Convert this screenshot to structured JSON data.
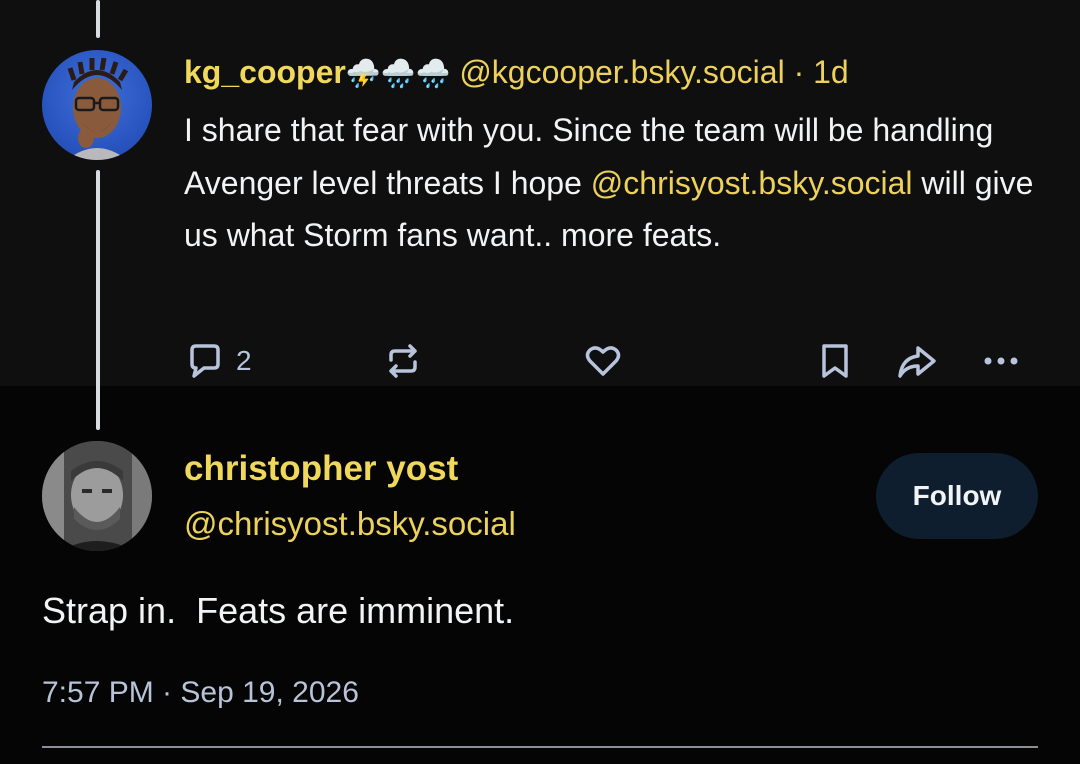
{
  "reply": {
    "display_name": "kg_cooper",
    "name_emojis": "⛈️🌧️🌧️",
    "handle": "@kgcooper.bsky.social",
    "separator": "·",
    "time_ago": "1d",
    "text_before": "I share that fear with you. Since the team will be handling Avenger level threats I hope ",
    "mention": "@chrisyost.bsky.social",
    "text_after": " will give us what Storm fans want.. more feats.",
    "reply_count": "2",
    "icons": [
      "reply-icon",
      "repost-icon",
      "like-icon",
      "bookmark-icon",
      "share-icon",
      "more-icon"
    ]
  },
  "post": {
    "display_name": "christopher yost",
    "handle": "@chrisyost.bsky.social",
    "follow_label": "Follow",
    "text": "Strap in.  Feats are imminent.",
    "timestamp": "7:57 PM · Sep 19, 2026"
  },
  "colors": {
    "accent": "#ECD15A",
    "background": "#050505",
    "card_background": "#0F0F10",
    "follow_button": "#0E1E2E",
    "icon": "#B7C4DB"
  }
}
